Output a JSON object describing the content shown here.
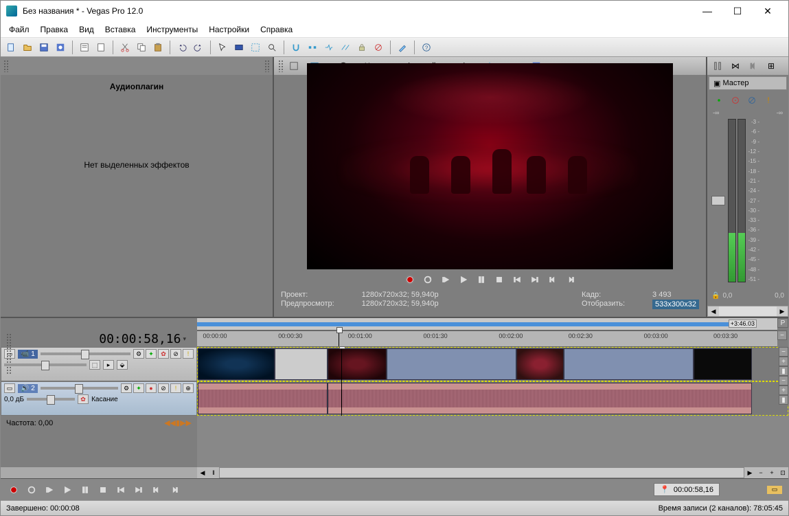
{
  "window": {
    "title": "Без названия * - Vegas Pro 12.0",
    "minimize": "—",
    "maximize": "☐",
    "close": "✕"
  },
  "menu": {
    "file": "Файл",
    "edit": "Правка",
    "view": "Вид",
    "insert": "Вставка",
    "tools": "Инструменты",
    "options": "Настройки",
    "help": "Справка"
  },
  "audio_panel": {
    "title": "Аудиоплагин",
    "empty": "Нет выделенных эффектов"
  },
  "preview": {
    "quality_label": "Наилучшее (полный размер)",
    "info1_label": "Проект:",
    "info1_value": "1280x720x32; 59,940p",
    "info2_label": "Предпросмотр:",
    "info2_value": "1280x720x32; 59,940p",
    "frame_label": "Кадр:",
    "frame_value": "3 493",
    "display_label": "Отобразить:",
    "display_value": "533x300x32"
  },
  "master": {
    "title": "Мастер",
    "neg_inf": "-∞",
    "db_left": "0,0",
    "db_right": "0,0",
    "scale": [
      "-3 -",
      "-6 -",
      "-9 -",
      "-12 -",
      "-15 -",
      "-18 -",
      "-21 -",
      "-24 -",
      "-27 -",
      "-30 -",
      "-33 -",
      "-36 -",
      "-39 -",
      "-42 -",
      "-45 -",
      "-48 -",
      "-51 -"
    ]
  },
  "timeline": {
    "timecode": "00:00:58,16",
    "marker_end": "+3:46.03",
    "ruler": [
      "00:00:00",
      "00:00:30",
      "00:01:00",
      "00:01:30",
      "00:02:00",
      "00:02:30",
      "00:03:00",
      "00:03:30"
    ],
    "track1_num": "1",
    "track2_num": "2",
    "track2_db": "0,0 дБ",
    "track2_touch": "Касание",
    "freq_label": "Частота: 0,00",
    "bottom_tc": "00:00:58,16"
  },
  "status": {
    "left": "Завершено: 00:00:08",
    "right": "Время записи (2 каналов): 78:05:45"
  }
}
